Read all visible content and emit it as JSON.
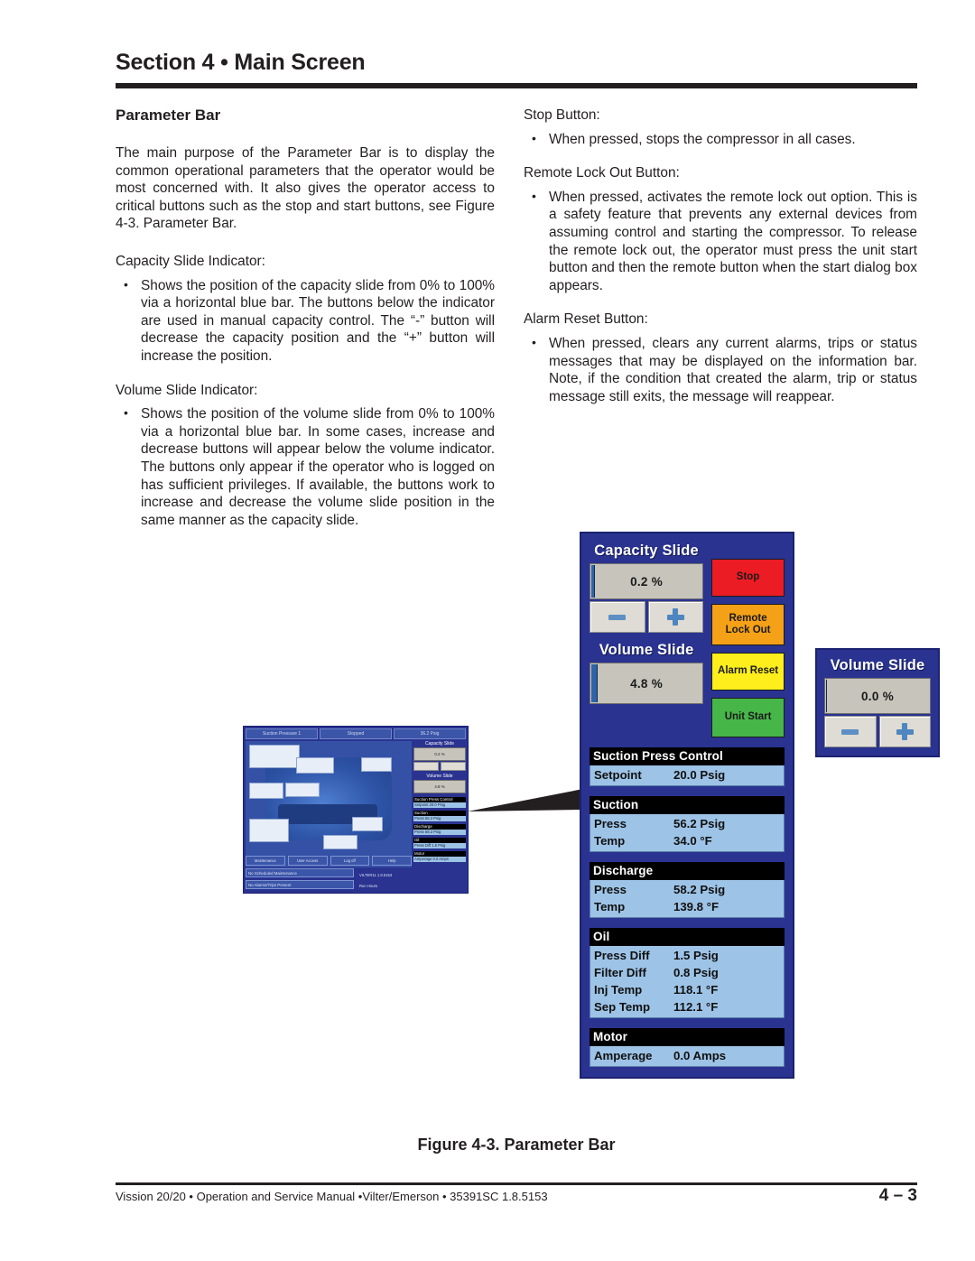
{
  "header": {
    "section_title": "Section 4 • Main Screen",
    "sub_head": "Parameter Bar"
  },
  "left_column": {
    "intro": "The main purpose of the Parameter Bar is to display the common operational parameters that the operator would be most concerned with. It also gives the operator access to critical buttons such as the stop and start buttons, see Figure 4-3. Parameter Bar.",
    "capacity_lead": "Capacity Slide Indicator:",
    "capacity_bullet": "Shows the position of the capacity slide from 0% to 100% via a horizontal blue bar. The buttons below the indicator are used in manual capacity control. The “-” button will decrease the capacity position and the “+” button will increase the position.",
    "volume_lead": "Volume Slide Indicator:",
    "volume_bullet": "Shows the position of the volume slide from 0% to 100% via a horizontal blue bar. In some cases, increase and decrease buttons will appear below the volume indicator. The buttons only appear if the operator who is logged on has sufficient privileges. If available, the buttons work to increase and decrease the volume slide position in the same manner as the capacity slide."
  },
  "right_column": {
    "stop_lead": "Stop Button:",
    "stop_bullet": "When pressed, stops the compressor in all cases.",
    "remote_lead": "Remote Lock Out Button:",
    "remote_bullet": "When pressed, activates the remote lock out option. This is a safety feature that prevents any external devices from assuming control and starting the compressor. To release the remote lock out, the operator must press the unit start button and then the remote button when the start dialog box appears.",
    "alarm_lead": "Alarm Reset Button:",
    "alarm_bullet": "When pressed, clears any current alarms, trips or status messages that may be displayed on the information bar. Note, if the condition that created the alarm, trip or status message still exits, the message will reappear."
  },
  "parameter_bar": {
    "capacity_slide": {
      "label": "Capacity Slide",
      "value": "0.2 %",
      "percent": 0.2,
      "decrease_label": "minus",
      "increase_label": "plus"
    },
    "volume_slide": {
      "label": "Volume Slide",
      "value": "4.8 %",
      "percent": 4.8
    },
    "buttons": {
      "stop": "Stop",
      "remote_lock_out": "Remote\nLock Out",
      "remote_lock_out_line1": "Remote",
      "remote_lock_out_line2": "Lock Out",
      "alarm_reset": "Alarm Reset",
      "unit_start": "Unit Start"
    },
    "colors": {
      "panel_blue": "#2a3390",
      "stop_red": "#ec1c24",
      "remote_orange": "#f5a117",
      "alarm_yellow": "#fdee1c",
      "start_green": "#46b648",
      "readout_gray": "#c6c4bb",
      "data_header_black": "#000000",
      "data_body_blue": "#9dc3e6",
      "bar_blue": "#2f64a8"
    },
    "data_blocks": [
      {
        "title": "Suction Press Control",
        "rows": [
          {
            "key": "Setpoint",
            "value": "20.0 Psig"
          }
        ]
      },
      {
        "title": "Suction",
        "rows": [
          {
            "key": "Press",
            "value": "56.2 Psig"
          },
          {
            "key": "Temp",
            "value": "34.0 °F"
          }
        ]
      },
      {
        "title": "Discharge",
        "rows": [
          {
            "key": "Press",
            "value": "58.2 Psig"
          },
          {
            "key": "Temp",
            "value": "139.8 °F"
          }
        ]
      },
      {
        "title": "Oil",
        "rows": [
          {
            "key": "Press Diff",
            "value": "1.5 Psig"
          },
          {
            "key": "Filter Diff",
            "value": "0.8 Psig"
          },
          {
            "key": "Inj Temp",
            "value": "118.1 °F"
          },
          {
            "key": "Sep Temp",
            "value": "112.1 °F"
          }
        ]
      },
      {
        "title": "Motor",
        "rows": [
          {
            "key": "Amperage",
            "value": "0.0 Amps"
          }
        ]
      }
    ]
  },
  "volume_panel": {
    "label": "Volume Slide",
    "value": "0.0 %",
    "percent": 0.0
  },
  "thumbnail": {
    "topbar": [
      "Suction Pressure 1",
      "Stopped",
      "36.2 Psig"
    ],
    "buttons": [
      "Maintenance",
      "User Access",
      "Log off",
      "Help"
    ],
    "status_1": "No Scheduled Maintenance",
    "status_2": "No Alarms/Trips Present",
    "info_user_label": "User",
    "info_user_value": "VILTER11 1.8.5153",
    "info_hours_label": "Run Hours",
    "info_hours_value": "21",
    "side_blocks": [
      {
        "title": "Suction Press Control",
        "body": "Setpoint  20.0 Psig"
      },
      {
        "title": "Suction",
        "body": "Press  56.2 Psig"
      },
      {
        "title": "Discharge",
        "body": "Press  58.2 Psig"
      },
      {
        "title": "Oil",
        "body": "Press Diff  1.5 Psig"
      },
      {
        "title": "Motor",
        "body": "Amperage  0.0 Amps"
      }
    ],
    "capacity_label": "Capacity Slide",
    "capacity_value": "0.2 %",
    "volume_label": "Volume Slide",
    "volume_value": "4.8 %"
  },
  "figure": {
    "caption": "Figure 4-3. Parameter Bar"
  },
  "footer": {
    "text": "Vission 20/20 • Operation and Service Manual •Vilter/Emerson • 35391SC 1.8.5153",
    "page": "4 – 3"
  }
}
